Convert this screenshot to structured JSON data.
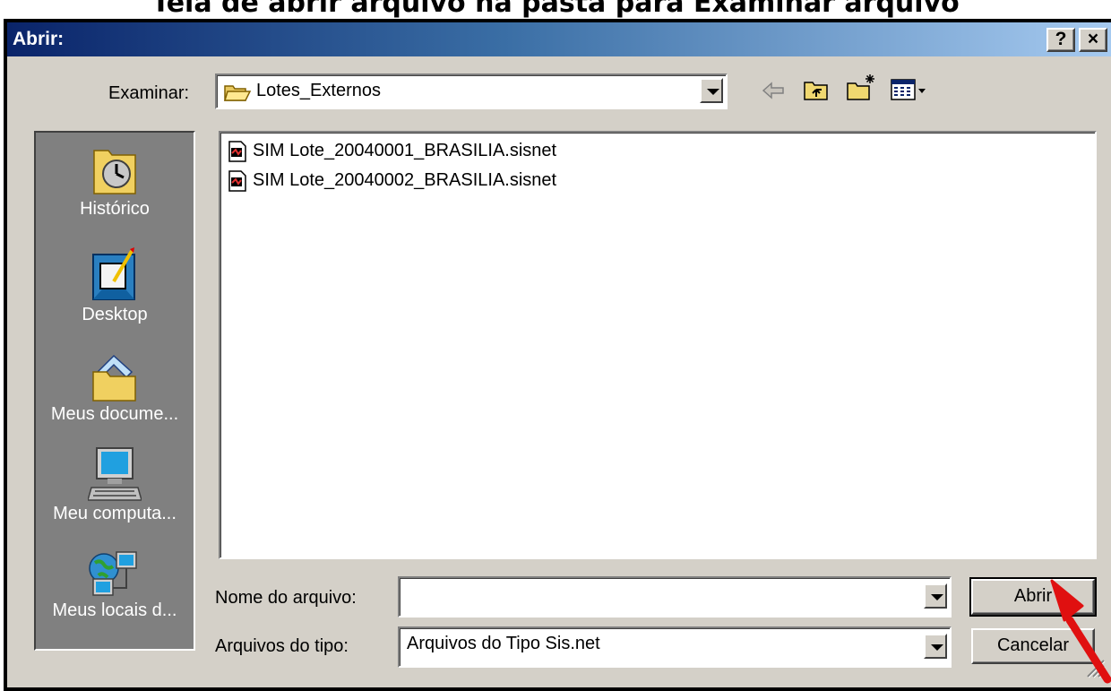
{
  "caption": "Tela de abrir arquivo na pasta para Examinar arquivo",
  "dialog": {
    "title": "Abrir:",
    "help_label": "?",
    "close_label": "×"
  },
  "toolbar": {
    "look_in_label": "Examinar:",
    "look_in_value": "Lotes_Externos",
    "icons": [
      "back-arrow-icon",
      "up-one-level-icon",
      "new-folder-icon",
      "view-menu-icon"
    ]
  },
  "places": [
    {
      "label": "Histórico",
      "icon": "history-icon"
    },
    {
      "label": "Desktop",
      "icon": "desktop-icon"
    },
    {
      "label": "Meus docume...",
      "icon": "my-documents-icon"
    },
    {
      "label": "Meu computa...",
      "icon": "my-computer-icon"
    },
    {
      "label": "Meus locais d...",
      "icon": "network-places-icon"
    }
  ],
  "files": [
    {
      "name": "SIM Lote_20040001_BRASILIA.sisnet"
    },
    {
      "name": "SIM Lote_20040002_BRASILIA.sisnet"
    }
  ],
  "filename": {
    "label": "Nome do arquivo:",
    "value": ""
  },
  "filetype": {
    "label": "Arquivos do tipo:",
    "value": "Arquivos do Tipo Sis.net"
  },
  "buttons": {
    "open": "Abrir",
    "cancel": "Cancelar"
  },
  "colors": {
    "titlebar_start": "#0a246a",
    "titlebar_end": "#a6caf0",
    "face": "#d4d0c8",
    "annotation_arrow": "#e01010"
  }
}
